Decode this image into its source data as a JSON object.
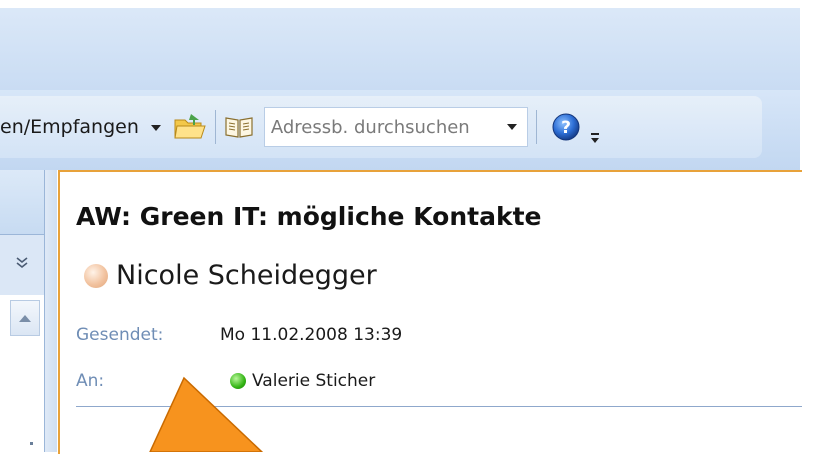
{
  "toolbar": {
    "send_receive_label": "en/Empfangen",
    "search": {
      "placeholder": "Adressb. durchsuchen"
    },
    "icons": {
      "send_receive_dropdown": "chevron-down-icon",
      "open_folder": "folder-icon",
      "address_book": "address-book-icon",
      "help": "help-icon",
      "overflow": "toolbar-overflow-icon"
    }
  },
  "message": {
    "subject": "AW: Green IT: mögliche Kontakte",
    "sender": "Nicole Scheidegger",
    "sent_label": "Gesendet:",
    "sent_value": "Mo 11.02.2008 13:39",
    "to_label": "An:",
    "to_value": "Valerie Sticher"
  },
  "colors": {
    "reading_pane_border": "#e8a23a",
    "label_blue": "#6f8db5",
    "callout_arrow": "#f7931e",
    "presence_online": "#33b414",
    "presence_unknown": "#f2c3a0"
  }
}
